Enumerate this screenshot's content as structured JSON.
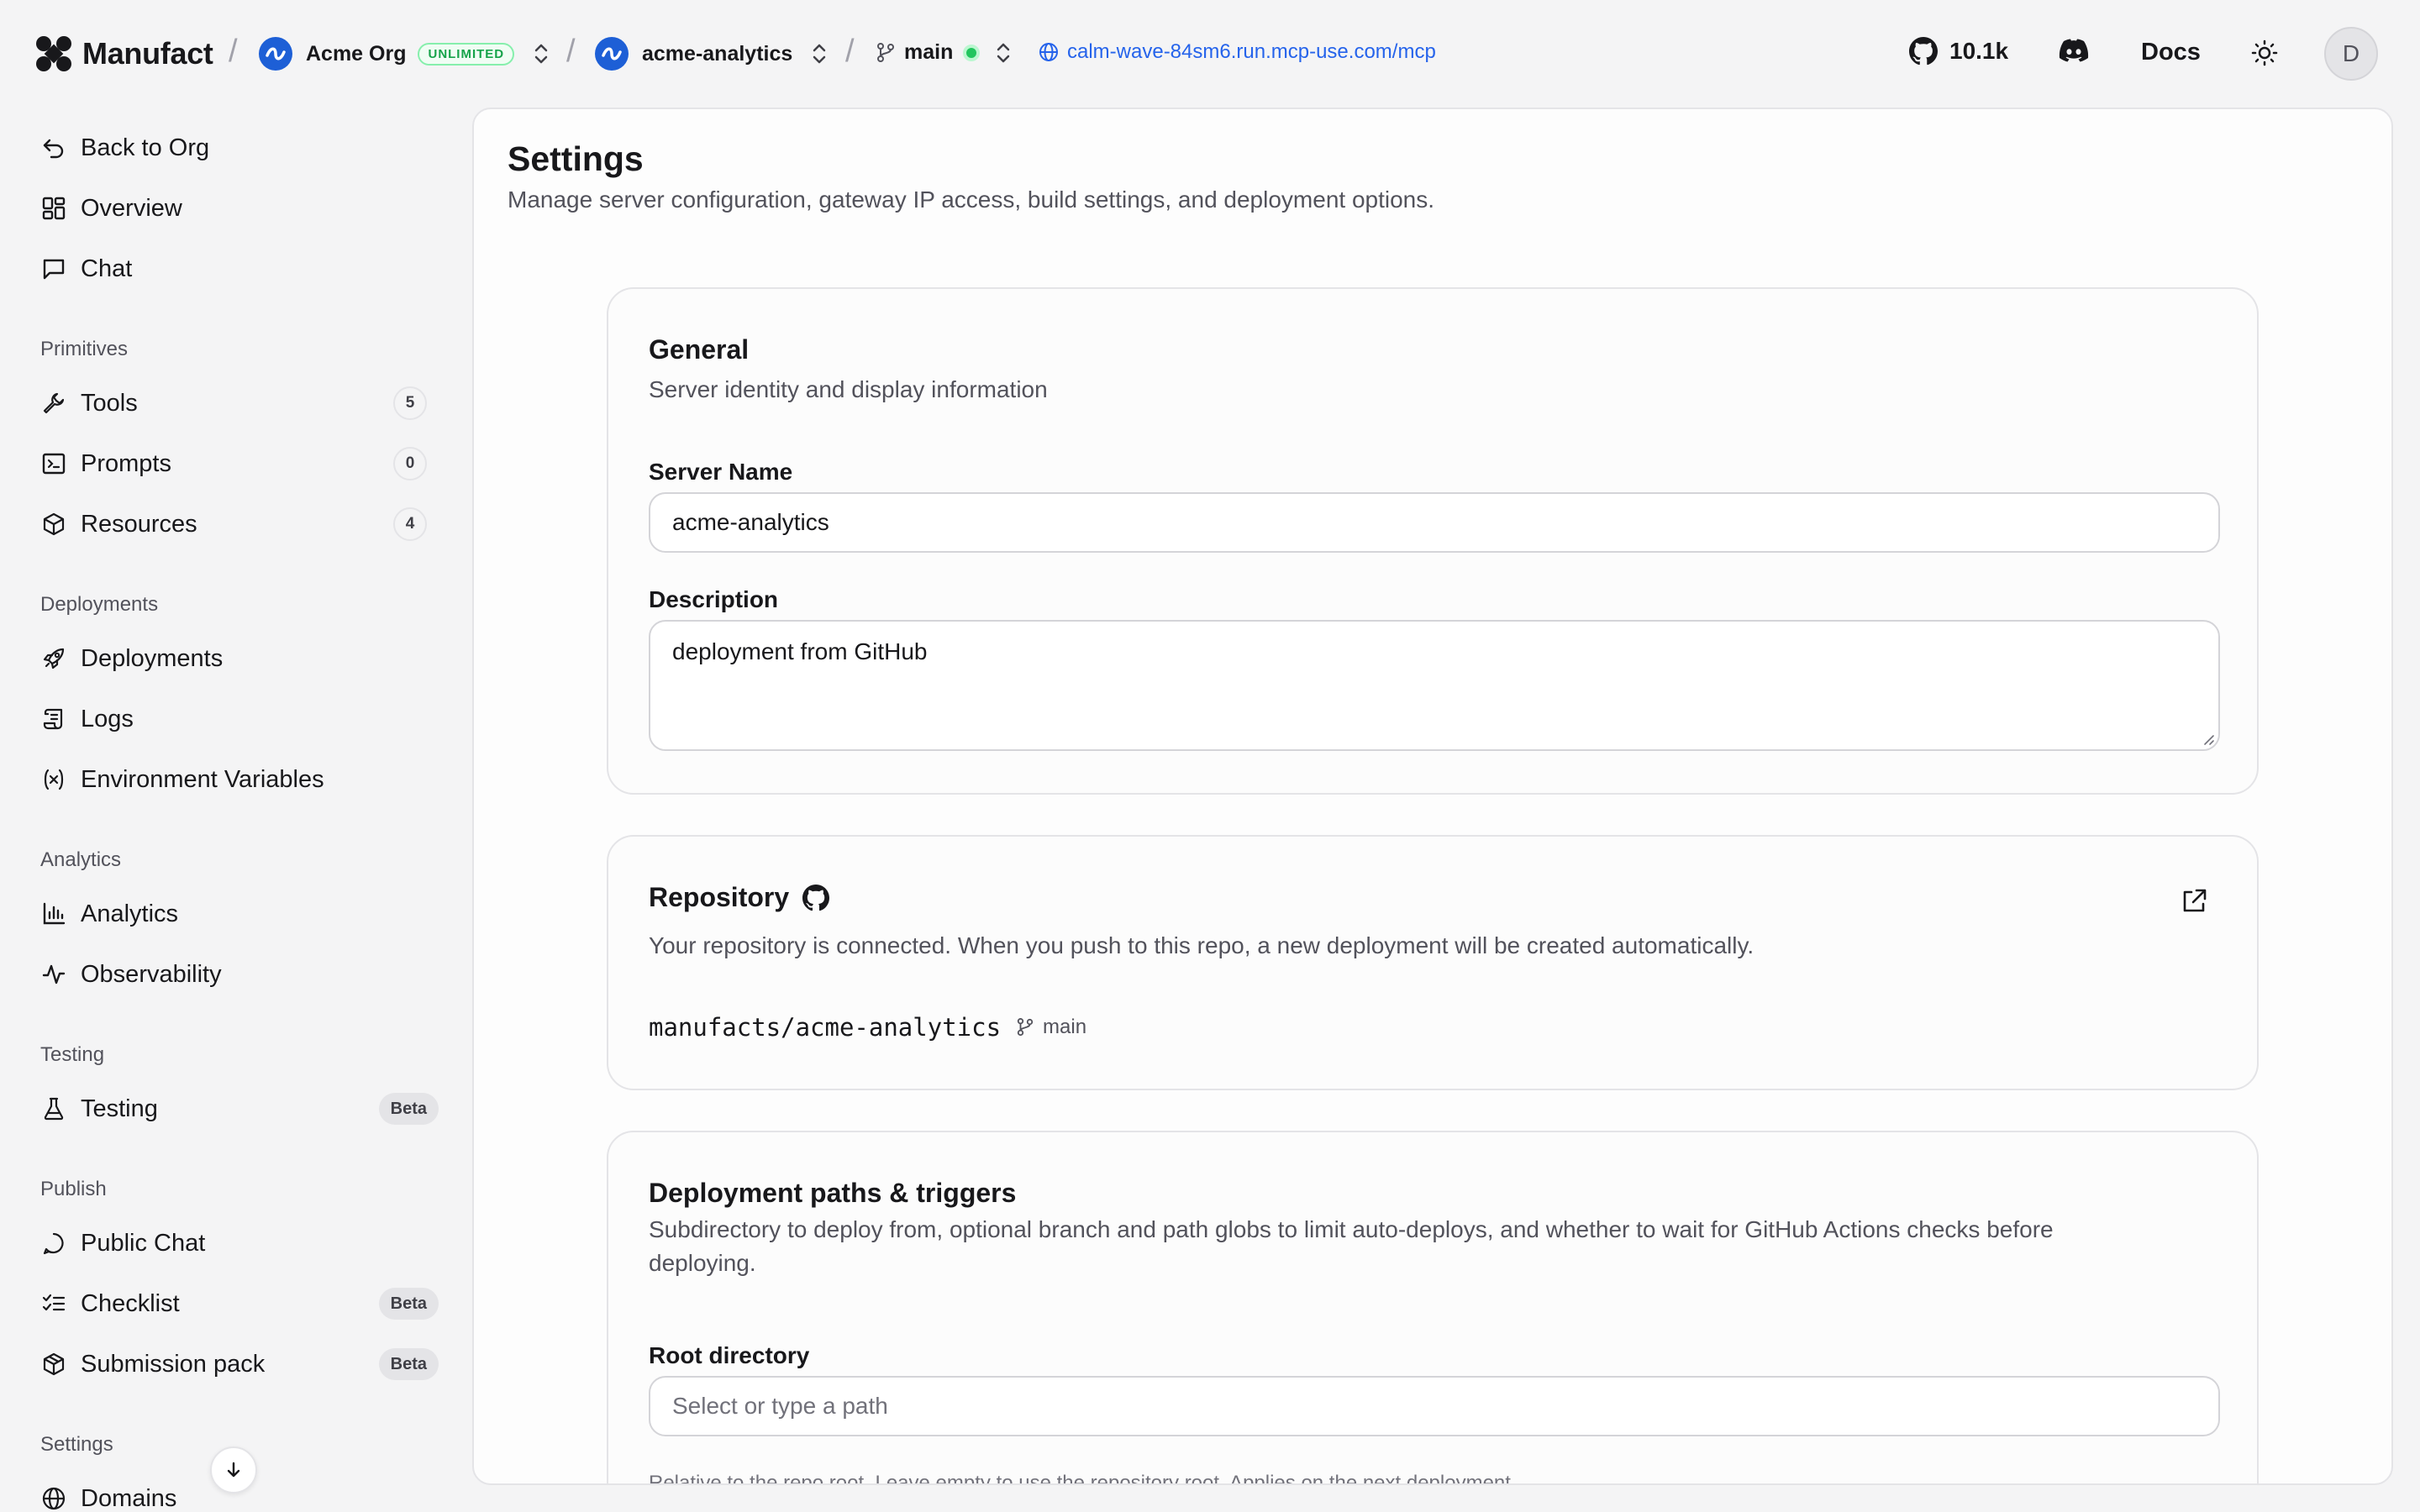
{
  "app": {
    "brand": "Manufact"
  },
  "topbar": {
    "org": {
      "name": "Acme Org",
      "plan": "UNLIMITED"
    },
    "project": {
      "name": "acme-analytics"
    },
    "branch": {
      "name": "main"
    },
    "url": "calm-wave-84sm6.run.mcp-use.com/mcp",
    "github_stars": "10.1k",
    "docs_label": "Docs",
    "user_initial": "D"
  },
  "sidebar": {
    "top": [
      {
        "label": "Back to Org",
        "icon": "undo-icon"
      },
      {
        "label": "Overview",
        "icon": "grid-icon"
      },
      {
        "label": "Chat",
        "icon": "chat-icon"
      }
    ],
    "sections": {
      "primitives": "Primitives",
      "deployments": "Deployments",
      "analytics": "Analytics",
      "testing": "Testing",
      "publish": "Publish",
      "settings": "Settings"
    },
    "primitives": [
      {
        "label": "Tools",
        "count": "5"
      },
      {
        "label": "Prompts",
        "count": "0"
      },
      {
        "label": "Resources",
        "count": "4"
      }
    ],
    "deployments": [
      {
        "label": "Deployments"
      },
      {
        "label": "Logs"
      },
      {
        "label": "Environment Variables"
      }
    ],
    "analytics": [
      {
        "label": "Analytics"
      },
      {
        "label": "Observability"
      }
    ],
    "testing": [
      {
        "label": "Testing",
        "badge": "Beta"
      }
    ],
    "publish": [
      {
        "label": "Public Chat"
      },
      {
        "label": "Checklist",
        "badge": "Beta"
      },
      {
        "label": "Submission pack",
        "badge": "Beta"
      }
    ],
    "settings": [
      {
        "label": "Domains"
      }
    ]
  },
  "main": {
    "title": "Settings",
    "subtitle": "Manage server configuration, gateway IP access, build settings, and deployment options.",
    "general": {
      "title": "General",
      "subtitle": "Server identity and display information",
      "server_name_label": "Server Name",
      "server_name_value": "acme-analytics",
      "description_label": "Description",
      "description_value": "deployment from GitHub"
    },
    "repository": {
      "title": "Repository",
      "subtitle": "Your repository is connected. When you push to this repo, a new deployment will be created automatically.",
      "repo": "manufacts/acme-analytics",
      "branch": "main"
    },
    "triggers": {
      "title": "Deployment paths & triggers",
      "subtitle_line1": "Subdirectory to deploy from, optional branch and path globs to limit auto-deploys, and whether to wait for GitHub Actions checks before",
      "subtitle_line2": "deploying.",
      "root_label": "Root directory",
      "root_placeholder": "Select or type a path",
      "root_note": "Relative to the repo root. Leave empty to use the repository root. Applies on the next deployment."
    }
  },
  "colors": {
    "accent": "#2563eb",
    "success": "#22c55e",
    "brand_blue": "#1d5fd6"
  }
}
